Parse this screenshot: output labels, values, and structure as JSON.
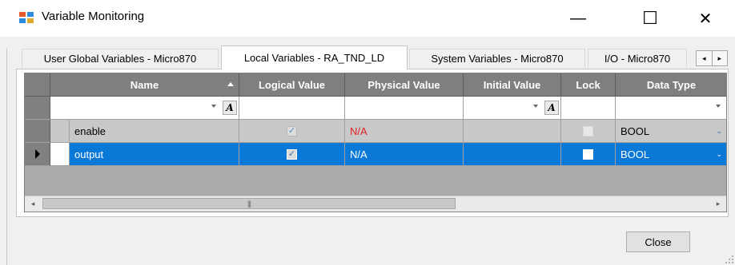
{
  "window": {
    "title": "Variable Monitoring",
    "minimize_glyph": "—",
    "maximize_glyph": "☐",
    "close_glyph": "✕",
    "icon": "app-grid-icon"
  },
  "tabs": [
    {
      "label": "User Global Variables - Micro870",
      "active": false
    },
    {
      "label": "Local Variables - RA_TND_LD",
      "active": true
    },
    {
      "label": "System Variables - Micro870",
      "active": false
    },
    {
      "label": "I/O - Micro870",
      "active": false
    }
  ],
  "tab_scroll": {
    "left": "◂",
    "right": "▸"
  },
  "grid": {
    "columns": [
      "Name",
      "Logical Value",
      "Physical Value",
      "Initial Value",
      "Lock",
      "Data Type"
    ],
    "filter_glyph": "A",
    "rows": [
      {
        "name": "enable",
        "logical_checked": true,
        "physical": "N/A",
        "initial": "",
        "lock_checked": false,
        "data_type": "BOOL",
        "selected": false
      },
      {
        "name": "output",
        "logical_checked": true,
        "physical": "N/A",
        "initial": "",
        "lock_checked": false,
        "data_type": "BOOL",
        "selected": true
      }
    ],
    "check_glyph": "✓",
    "combo_caret": "⌄",
    "scroll": {
      "left": "◂",
      "right": "▸",
      "thumb_grip": "|||"
    }
  },
  "footer": {
    "close_label": "Close"
  },
  "colors": {
    "selection": "#0a78d7",
    "header": "#7f7f7f",
    "na_text_unselected": "#e02020"
  }
}
